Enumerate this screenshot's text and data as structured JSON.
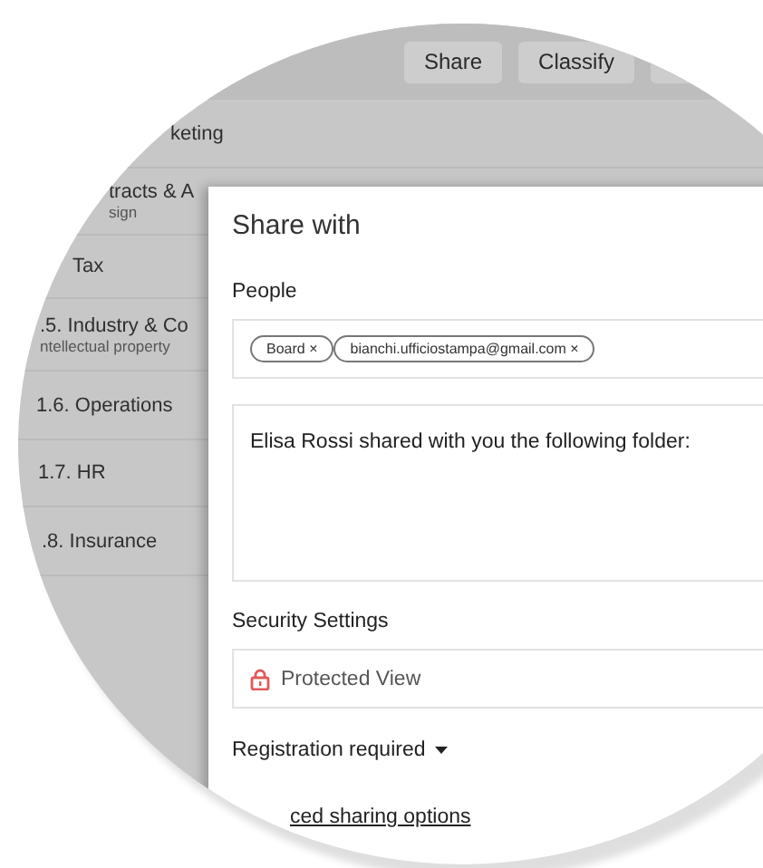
{
  "toolbar": {
    "buttons": [
      {
        "label": "Share"
      },
      {
        "label": "Classify"
      }
    ]
  },
  "sidebar": {
    "items": [
      {
        "label": "keting"
      },
      {
        "label": "tracts & A",
        "sublabel": "sign"
      },
      {
        "label": "Tax"
      },
      {
        "label": ".5. Industry & Co",
        "sublabel": "ntellectual property"
      },
      {
        "label": "1.6. Operations"
      },
      {
        "label": "1.7. HR"
      },
      {
        "label": ".8. Insurance"
      }
    ]
  },
  "dialog": {
    "title": "Share with",
    "people_label": "People",
    "recipients": [
      {
        "name": "Board",
        "remove": "×"
      },
      {
        "name": "bianchi.ufficiostampa@gmail.com",
        "remove": "×"
      }
    ],
    "message": "Elisa Rossi shared with you the following folder:",
    "security_label": "Security Settings",
    "security_value": "Protected View",
    "registration": "Registration required",
    "link": "ced sharing options"
  }
}
